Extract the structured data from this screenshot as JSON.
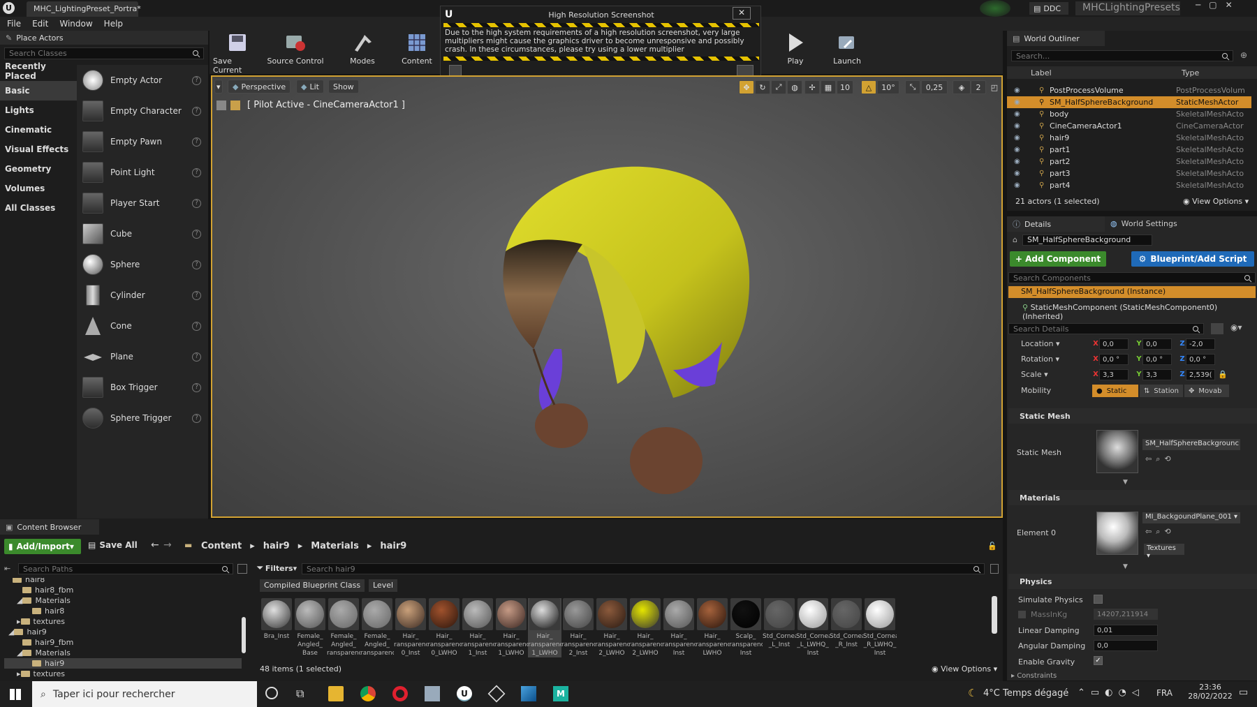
{
  "window": {
    "tab_title": "MHC_LightingPreset_Portra*",
    "ddc_label": "DDC",
    "project_name": "MHCLightingPresets"
  },
  "menu": [
    "File",
    "Edit",
    "Window",
    "Help"
  ],
  "place_actors": {
    "title": "Place Actors",
    "search_placeholder": "Search Classes",
    "categories": [
      "Recently Placed",
      "Basic",
      "Lights",
      "Cinematic",
      "Visual Effects",
      "Geometry",
      "Volumes",
      "All Classes"
    ],
    "selected_category": "Basic",
    "actors": [
      "Empty Actor",
      "Empty Character",
      "Empty Pawn",
      "Point Light",
      "Player Start",
      "Cube",
      "Sphere",
      "Cylinder",
      "Cone",
      "Plane",
      "Box Trigger",
      "Sphere Trigger"
    ]
  },
  "toolbar": {
    "save_current": "Save Current",
    "source_control": "Source Control",
    "modes": "Modes",
    "content": "Content",
    "play": "Play",
    "launch": "Launch"
  },
  "dialog": {
    "title": "High Resolution Screenshot",
    "message": "Due to the high system requirements of a high resolution screenshot, very large multipliers might cause the graphics driver to become unresponsive and possibly crash. In these circumstances, please try using a lower multiplier"
  },
  "viewport": {
    "perspective": "Perspective",
    "lit": "Lit",
    "show": "Show",
    "pilot_label": "[ Pilot Active - CineCameraActor1 ]",
    "grid_snap": "10",
    "rot_snap": "10°",
    "scale_snap": "0,25",
    "cam_speed": "2"
  },
  "outliner": {
    "title": "World Outliner",
    "search_placeholder": "Search...",
    "col_label": "Label",
    "col_type": "Type",
    "rows": [
      {
        "name": "PostProcessVolume",
        "type": "PostProcessVolum",
        "selected": false
      },
      {
        "name": "SM_HalfSphereBackground",
        "type": "StaticMeshActor",
        "selected": true
      },
      {
        "name": "body",
        "type": "SkeletalMeshActo",
        "selected": false
      },
      {
        "name": "CineCameraActor1",
        "type": "CineCameraActor",
        "selected": false
      },
      {
        "name": "hair9",
        "type": "SkeletalMeshActo",
        "selected": false
      },
      {
        "name": "part1",
        "type": "SkeletalMeshActo",
        "selected": false
      },
      {
        "name": "part2",
        "type": "SkeletalMeshActo",
        "selected": false
      },
      {
        "name": "part3",
        "type": "SkeletalMeshActo",
        "selected": false
      },
      {
        "name": "part4",
        "type": "SkeletalMeshActo",
        "selected": false
      }
    ],
    "status": "21 actors (1 selected)",
    "view_options": "View Options"
  },
  "details": {
    "tab_details": "Details",
    "tab_world": "World Settings",
    "actor_name": "SM_HalfSphereBackground",
    "add_component": "+ Add Component",
    "blueprint": "Blueprint/Add Script",
    "search_components": "Search Components",
    "instance": "SM_HalfSphereBackground (Instance)",
    "component": "StaticMeshComponent (StaticMeshComponent0) (Inherited)",
    "search_details": "Search Details",
    "transform": {
      "location_label": "Location",
      "rotation_label": "Rotation",
      "scale_label": "Scale",
      "mobility_label": "Mobility",
      "location": [
        "0,0",
        "0,0",
        "-2,0"
      ],
      "rotation": [
        "0,0 °",
        "0,0 °",
        "0,0 °"
      ],
      "scale": [
        "3,3",
        "3,3",
        "2,539("
      ]
    },
    "mobility": [
      "Static",
      "Station",
      "Movab"
    ],
    "static_mesh_section": "Static Mesh",
    "static_mesh_label": "Static Mesh",
    "static_mesh_value": "SM_HalfSphereBackgrounc",
    "materials_section": "Materials",
    "element0_label": "Element 0",
    "material_value": "MI_BackgoundPlane_001",
    "textures": "Textures",
    "physics_section": "Physics",
    "physics": {
      "simulate": "Simulate Physics",
      "mass": "MassInKg",
      "mass_value": "14207,211914",
      "linear": "Linear Damping",
      "linear_value": "0,01",
      "angular": "Angular Damping",
      "angular_value": "0,0",
      "gravity": "Enable Gravity",
      "constraints": "Constraints"
    }
  },
  "content_browser": {
    "title": "Content Browser",
    "add_import": "Add/Import",
    "save_all": "Save All",
    "path": [
      "Content",
      "hair9",
      "Materials",
      "hair9"
    ],
    "search_paths": "Search Paths",
    "filters": "Filters",
    "search_assets": "Search hair9",
    "filter_chips": [
      "Compiled Blueprint Class",
      "Level"
    ],
    "tree": [
      "hair8",
      "hair8_fbm",
      "Materials",
      "hair8",
      "textures",
      "hair9",
      "hair9_fbm",
      "Materials",
      "hair9",
      "textures"
    ],
    "assets": [
      {
        "cap": "Bra_Inst",
        "c1": "#e0e0e0",
        "c2": "#333"
      },
      {
        "cap": "Female_\nAngled_\nBase",
        "c1": "#bbb",
        "c2": "#555"
      },
      {
        "cap": "Female_\nAngled_\nranspareno",
        "c1": "#aaa",
        "c2": "#666"
      },
      {
        "cap": "Female_\nAngled_\nranspareno",
        "c1": "#aaa",
        "c2": "#666"
      },
      {
        "cap": "Hair_\nranspareno\n0_Inst",
        "c1": "#c9a07a",
        "c2": "#3b2a22"
      },
      {
        "cap": "Hair_\nranspareno\n0_LWHO",
        "c1": "#a0522d",
        "c2": "#2b150c"
      },
      {
        "cap": "Hair_\nranspareno\n1_Inst",
        "c1": "#bbb",
        "c2": "#555"
      },
      {
        "cap": "Hair_\nranspareno\n1_LWHO",
        "c1": "#c59a85",
        "c2": "#3a2520"
      },
      {
        "cap": "Hair_\nranspareno\n1_LWHO",
        "c1": "#ddd",
        "c2": "#111"
      },
      {
        "cap": "Hair_\nranspareno\n2_Inst",
        "c1": "#999",
        "c2": "#444"
      },
      {
        "cap": "Hair_\nranspareno\n2_LWHO",
        "c1": "#8b5a3c",
        "c2": "#2a1a12"
      },
      {
        "cap": "Hair_\nranspareno\n2_LWHO",
        "c1": "#e6e600",
        "c2": "#333"
      },
      {
        "cap": "Hair_\nranspareno\nInst",
        "c1": "#aaa",
        "c2": "#555"
      },
      {
        "cap": "Hair_\nranspareno\nLWHO",
        "c1": "#a5623c",
        "c2": "#2a150c"
      },
      {
        "cap": "Scalp_\nranspareno\nInst",
        "c1": "#111",
        "c2": "#000"
      },
      {
        "cap": "Std_Cornea\n_L_Inst",
        "c1": "#666",
        "c2": "#444"
      },
      {
        "cap": "Std_Cornea\n_L_LWHQ_\nInst",
        "c1": "#fff",
        "c2": "#999"
      },
      {
        "cap": "Std_Cornea\n_R_Inst",
        "c1": "#666",
        "c2": "#444"
      },
      {
        "cap": "Std_Cornea\n_R_LWHQ_\nInst",
        "c1": "#fff",
        "c2": "#999"
      }
    ],
    "status": "48 items (1 selected)",
    "view_options": "View Options"
  },
  "taskbar": {
    "search": "Taper ici pour rechercher",
    "weather": "4°C  Temps dégagé",
    "lang": "FRA",
    "time": "23:36",
    "date": "28/02/2022"
  }
}
